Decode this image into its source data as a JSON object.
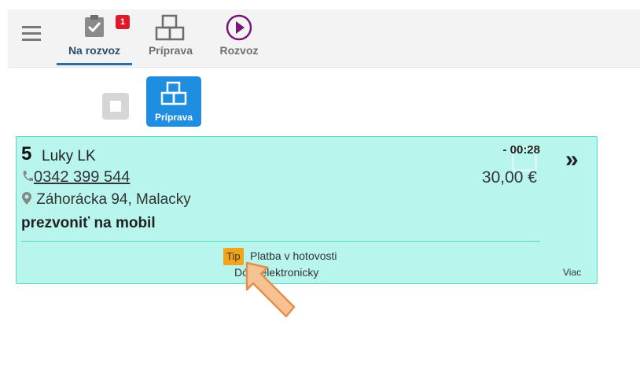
{
  "nav": {
    "tabs": [
      {
        "label": "Na rozvoz",
        "badge": "1",
        "icon": "clipboard-check-icon",
        "active": true
      },
      {
        "label": "Príprava",
        "icon": "boxes-icon"
      },
      {
        "label": "Rozvoz",
        "icon": "play-circle-icon"
      }
    ],
    "menu_icon": "hamburger-icon"
  },
  "filter": {
    "button_label": "Príprava",
    "button_icon": "boxes-icon"
  },
  "order": {
    "number": "5",
    "customer": "Luky LK",
    "phone": "0342 399 544",
    "address": "Záhorácka 94, Malacky",
    "note": "prezvoniť na mobil",
    "time": "- 00:28",
    "price": "30,00 €",
    "tip_label": "Tip",
    "payment_method": "Platba v hotovosti",
    "payment_secondary": "Dó... elektronicky",
    "more_label": "Viac",
    "open_label": "»"
  },
  "colors": {
    "accent": "#1f8ee0",
    "card_bg": "#b8f5ec",
    "badge": "#e0182b",
    "tip": "#f2a51a",
    "rozvoz": "#7a1477"
  }
}
